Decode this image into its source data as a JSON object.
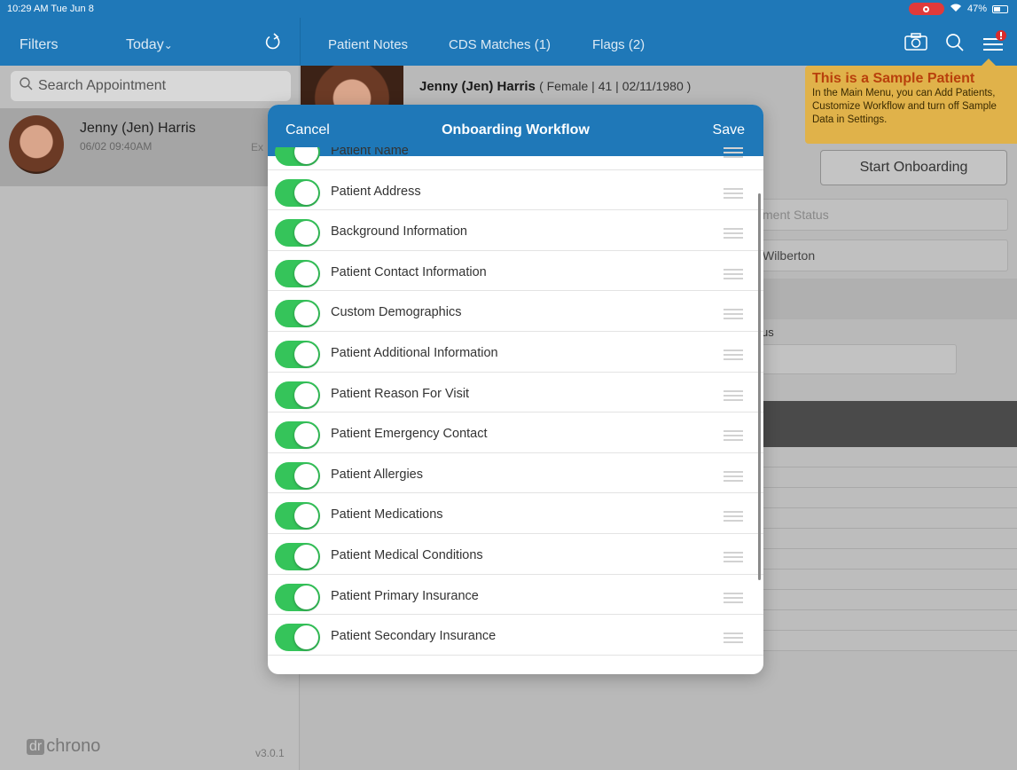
{
  "status": {
    "time": "10:29 AM  Tue Jun 8",
    "battery": "47%"
  },
  "left_nav": {
    "filters": "Filters",
    "today": "Today",
    "today_chevron": "⌄"
  },
  "main_nav": {
    "tabs": [
      "Patient Notes",
      "CDS Matches (1)",
      "Flags (2)"
    ]
  },
  "sidebar": {
    "search_placeholder": "Search Appointment",
    "appointment": {
      "name": "Jenny (Jen) Harris",
      "time": "06/02 09:40AM",
      "type": "Ex"
    },
    "logo_dr": "dr",
    "logo_text": "chrono",
    "version": "v3.0.1"
  },
  "patient": {
    "name": "Jenny (Jen) Harris",
    "details": "( Female | 41 | 02/11/1980 )"
  },
  "callout": {
    "title": "This is a Sample Patient",
    "text": "In the Main Menu, you can Add Patients, Customize Workflow and turn off Sample Data in Settings."
  },
  "start_button": "Start Onboarding",
  "background_fields": {
    "status": "ment Status",
    "provider": "Wilberton",
    "label": "us"
  },
  "modal": {
    "cancel": "Cancel",
    "title": "Onboarding Workflow",
    "save": "Save",
    "items": [
      {
        "label": "Patient Name",
        "enabled": true
      },
      {
        "label": "Patient Address",
        "enabled": true
      },
      {
        "label": "Background Information",
        "enabled": true
      },
      {
        "label": "Patient Contact Information",
        "enabled": true
      },
      {
        "label": "Custom Demographics",
        "enabled": true
      },
      {
        "label": "Patient Additional Information",
        "enabled": true
      },
      {
        "label": "Patient Reason For Visit",
        "enabled": true
      },
      {
        "label": "Patient Emergency Contact",
        "enabled": true
      },
      {
        "label": "Patient Allergies",
        "enabled": true
      },
      {
        "label": "Patient Medications",
        "enabled": true
      },
      {
        "label": "Patient Medical Conditions",
        "enabled": true
      },
      {
        "label": "Patient Primary Insurance",
        "enabled": true
      },
      {
        "label": "Patient Secondary Insurance",
        "enabled": true
      }
    ]
  }
}
